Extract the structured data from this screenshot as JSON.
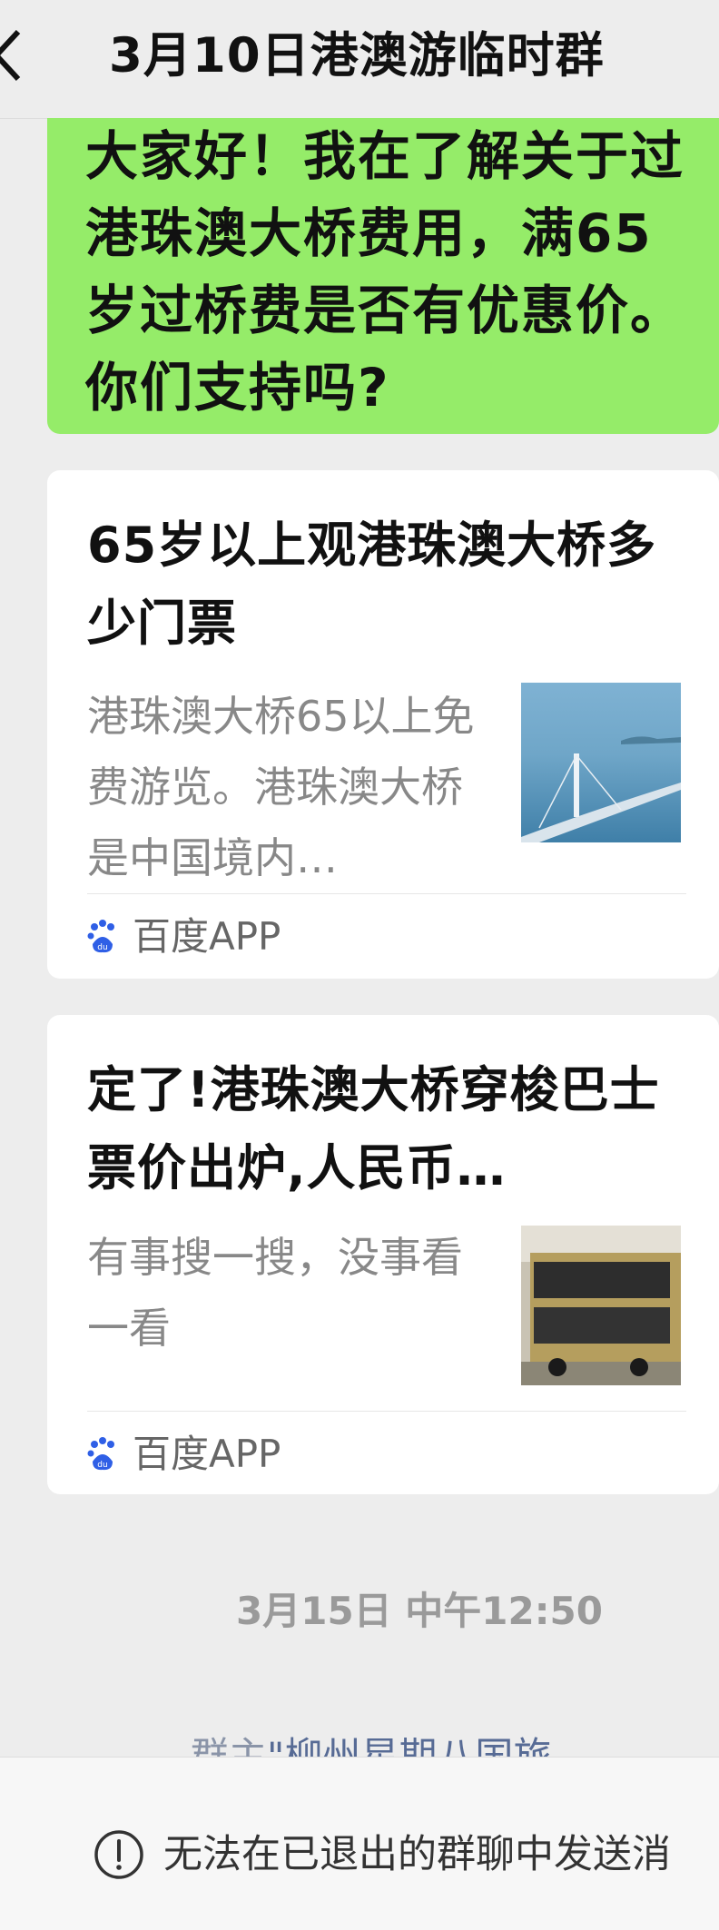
{
  "header": {
    "title": "3月10日港澳游临时群",
    "back_icon": "chevron-left-icon"
  },
  "messages": {
    "outgoing_text": "大家好！我在了解关于过港珠澳大桥费用，满65 岁过桥费是否有优惠价。你们支持吗?"
  },
  "cards": [
    {
      "title": "65岁以上观港珠澳大桥多少门票",
      "description": "港珠澳大桥65以上免费游览。港珠澳大桥是中国境内…",
      "source": "百度APP",
      "thumbnail": "bridge-photo"
    },
    {
      "title": "定了!港珠澳大桥穿梭巴士票价出炉,人民币…",
      "description": "有事搜一搜，没事看一看",
      "source": "百度APP",
      "thumbnail": "bus-photo"
    }
  ],
  "timestamp": "3月15日 中午12:50",
  "system_message": {
    "prefix": "群主",
    "name": "\"柳州星期八国旅"
  },
  "bottom_bar": {
    "notice": "无法在已退出的群聊中发送消",
    "icon": "info-circle-icon"
  },
  "colors": {
    "background": "#ededed",
    "bubble_green": "#95ec69",
    "card_white": "#ffffff",
    "link_blue": "#576b95",
    "baidu_blue": "#2f5fe6",
    "baidu_red": "#e0392e"
  }
}
